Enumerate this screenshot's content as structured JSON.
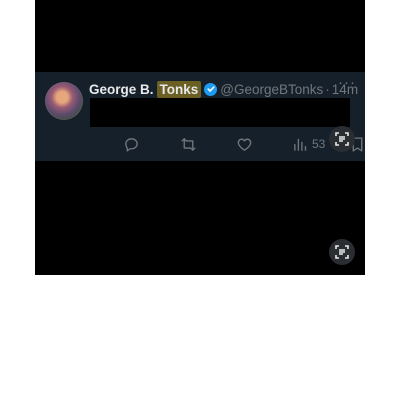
{
  "tweet": {
    "display_name_part1": "George B.",
    "display_name_part2": "Tonks",
    "handle": "@GeorgeBTonks",
    "separator": "·",
    "timestamp": "14m",
    "more_label": "···",
    "views_count": "53"
  },
  "icons": {
    "reply": "reply-icon",
    "retweet": "retweet-icon",
    "like": "heart-icon",
    "views": "views-icon",
    "bookmark": "bookmark-icon",
    "lens": "text-scan-icon"
  },
  "colors": {
    "tweet_background": "#15202b",
    "verified": "#1d9bf0",
    "muted_text": "#71767b",
    "highlight": "#6b5f24"
  }
}
